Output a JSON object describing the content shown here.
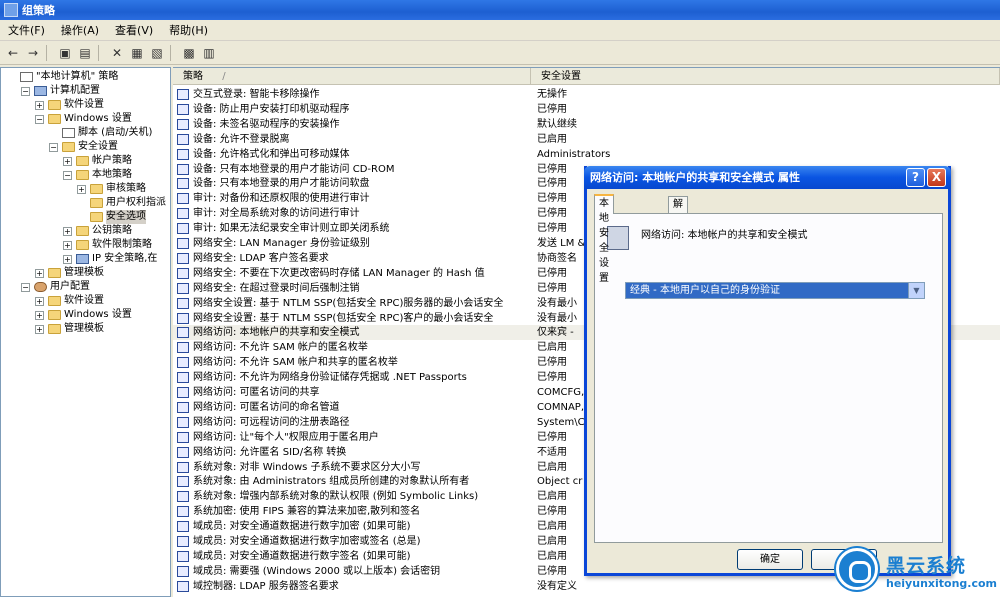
{
  "window": {
    "title": "组策略"
  },
  "menu": [
    "文件(F)",
    "操作(A)",
    "查看(V)",
    "帮助(H)"
  ],
  "toolbar_icons": [
    "back-arrow-icon",
    "forward-arrow-icon",
    "up-folder-icon",
    "show-tree-icon",
    "delete-icon",
    "properties-icon",
    "refresh-icon",
    "export-icon",
    "help-icon",
    "console-icon"
  ],
  "tree": [
    {
      "label": "\"本地计算机\" 策略",
      "indent": 0,
      "icon": "policy-icon",
      "toggle": ""
    },
    {
      "label": "计算机配置",
      "indent": 1,
      "icon": "computer-icon",
      "toggle": "−"
    },
    {
      "label": "软件设置",
      "indent": 2,
      "icon": "folder-icon",
      "toggle": "+"
    },
    {
      "label": "Windows 设置",
      "indent": 2,
      "icon": "folder-icon",
      "toggle": "−"
    },
    {
      "label": "脚本 (启动/关机)",
      "indent": 3,
      "icon": "document-icon",
      "toggle": ""
    },
    {
      "label": "安全设置",
      "indent": 3,
      "icon": "security-icon",
      "toggle": "−"
    },
    {
      "label": "帐户策略",
      "indent": 4,
      "icon": "folder-icon",
      "toggle": "+"
    },
    {
      "label": "本地策略",
      "indent": 4,
      "icon": "folder-icon",
      "toggle": "−"
    },
    {
      "label": "审核策略",
      "indent": 5,
      "icon": "folder-icon",
      "toggle": "+"
    },
    {
      "label": "用户权利指派",
      "indent": 5,
      "icon": "folder-icon",
      "toggle": ""
    },
    {
      "label": "安全选项",
      "indent": 5,
      "icon": "folder-icon",
      "toggle": "",
      "selected": true
    },
    {
      "label": "公钥策略",
      "indent": 4,
      "icon": "folder-icon",
      "toggle": "+"
    },
    {
      "label": "软件限制策略",
      "indent": 4,
      "icon": "folder-icon",
      "toggle": "+"
    },
    {
      "label": "IP 安全策略,在",
      "indent": 4,
      "icon": "ip-security-icon",
      "toggle": "+"
    },
    {
      "label": "管理模板",
      "indent": 2,
      "icon": "folder-icon",
      "toggle": "+"
    },
    {
      "label": "用户配置",
      "indent": 1,
      "icon": "user-icon",
      "toggle": "−"
    },
    {
      "label": "软件设置",
      "indent": 2,
      "icon": "folder-icon",
      "toggle": "+"
    },
    {
      "label": "Windows 设置",
      "indent": 2,
      "icon": "folder-icon",
      "toggle": "+"
    },
    {
      "label": "管理模板",
      "indent": 2,
      "icon": "folder-icon",
      "toggle": "+"
    }
  ],
  "list": {
    "columns": [
      "策略",
      "安全设置"
    ],
    "sort_indicator": "/",
    "rows": [
      {
        "policy": "交互式登录: 智能卡移除操作",
        "setting": "无操作"
      },
      {
        "policy": "设备: 防止用户安装打印机驱动程序",
        "setting": "已停用"
      },
      {
        "policy": "设备: 未签名驱动程序的安装操作",
        "setting": "默认继续"
      },
      {
        "policy": "设备: 允许不登录脱离",
        "setting": "已启用"
      },
      {
        "policy": "设备: 允许格式化和弹出可移动媒体",
        "setting": "Administrators"
      },
      {
        "policy": "设备: 只有本地登录的用户才能访问 CD-ROM",
        "setting": "已停用"
      },
      {
        "policy": "设备: 只有本地登录的用户才能访问软盘",
        "setting": "已停用"
      },
      {
        "policy": "审计: 对备份和还原权限的使用进行审计",
        "setting": "已停用"
      },
      {
        "policy": "审计: 对全局系统对象的访问进行审计",
        "setting": "已停用"
      },
      {
        "policy": "审计: 如果无法纪录安全审计则立即关闭系统",
        "setting": "已停用"
      },
      {
        "policy": "网络安全: LAN Manager 身份验证级别",
        "setting": "发送 LM &"
      },
      {
        "policy": "网络安全: LDAP 客户签名要求",
        "setting": "协商签名"
      },
      {
        "policy": "网络安全: 不要在下次更改密码时存储 LAN Manager 的 Hash 值",
        "setting": "已停用"
      },
      {
        "policy": "网络安全: 在超过登录时间后强制注销",
        "setting": "已停用"
      },
      {
        "policy": "网络安全设置: 基于 NTLM SSP(包括安全 RPC)服务器的最小会话安全",
        "setting": "没有最小"
      },
      {
        "policy": "网络安全设置: 基于 NTLM SSP(包括安全 RPC)客户的最小会话安全",
        "setting": "没有最小"
      },
      {
        "policy": "网络访问: 本地帐户的共享和安全模式",
        "setting": "仅来宾 -",
        "highlight": true
      },
      {
        "policy": "网络访问: 不允许 SAM 帐户的匿名枚举",
        "setting": "已启用"
      },
      {
        "policy": "网络访问: 不允许 SAM 帐户和共享的匿名枚举",
        "setting": "已停用"
      },
      {
        "policy": "网络访问: 不允许为网络身份验证储存凭据或 .NET Passports",
        "setting": "已停用"
      },
      {
        "policy": "网络访问: 可匿名访问的共享",
        "setting": "COMCFG,DF"
      },
      {
        "policy": "网络访问: 可匿名访问的命名管道",
        "setting": "COMNAP,CO"
      },
      {
        "policy": "网络访问: 可远程访问的注册表路径",
        "setting": "System\\Cu"
      },
      {
        "policy": "网络访问: 让\"每个人\"权限应用于匿名用户",
        "setting": "已停用"
      },
      {
        "policy": "网络访问: 允许匿名 SID/名称 转换",
        "setting": "不适用"
      },
      {
        "policy": "系统对象: 对非 Windows 子系统不要求区分大小写",
        "setting": "已启用"
      },
      {
        "policy": "系统对象: 由 Administrators 组成员所创建的对象默认所有者",
        "setting": "Object cr"
      },
      {
        "policy": "系统对象: 增强内部系统对象的默认权限 (例如 Symbolic Links)",
        "setting": "已启用"
      },
      {
        "policy": "系统加密: 使用 FIPS 兼容的算法来加密,散列和签名",
        "setting": "已停用"
      },
      {
        "policy": "域成员: 对安全通道数据进行数字加密 (如果可能)",
        "setting": "已启用"
      },
      {
        "policy": "域成员: 对安全通道数据进行数字加密或签名 (总是)",
        "setting": "已启用"
      },
      {
        "policy": "域成员: 对安全通道数据进行数字签名 (如果可能)",
        "setting": "已启用"
      },
      {
        "policy": "域成员: 需要强 (Windows 2000 或以上版本) 会话密钥",
        "setting": "已停用"
      },
      {
        "policy": "域控制器: LDAP 服务器签名要求",
        "setting": "没有定义"
      }
    ]
  },
  "dialog": {
    "title": "网络访问: 本地帐户的共享和安全模式 属性",
    "help": "?",
    "close": "X",
    "tabs": [
      "本地安全设置",
      "解释此设置"
    ],
    "policy_name": "网络访问: 本地帐户的共享和安全模式",
    "selected_value": "经典 - 本地用户以自己的身份验证",
    "ok": "确定",
    "cancel": "取"
  },
  "watermark": {
    "title": "黑云系统",
    "url": "heiyunxitong.com",
    "color": "#1b7fd1"
  }
}
